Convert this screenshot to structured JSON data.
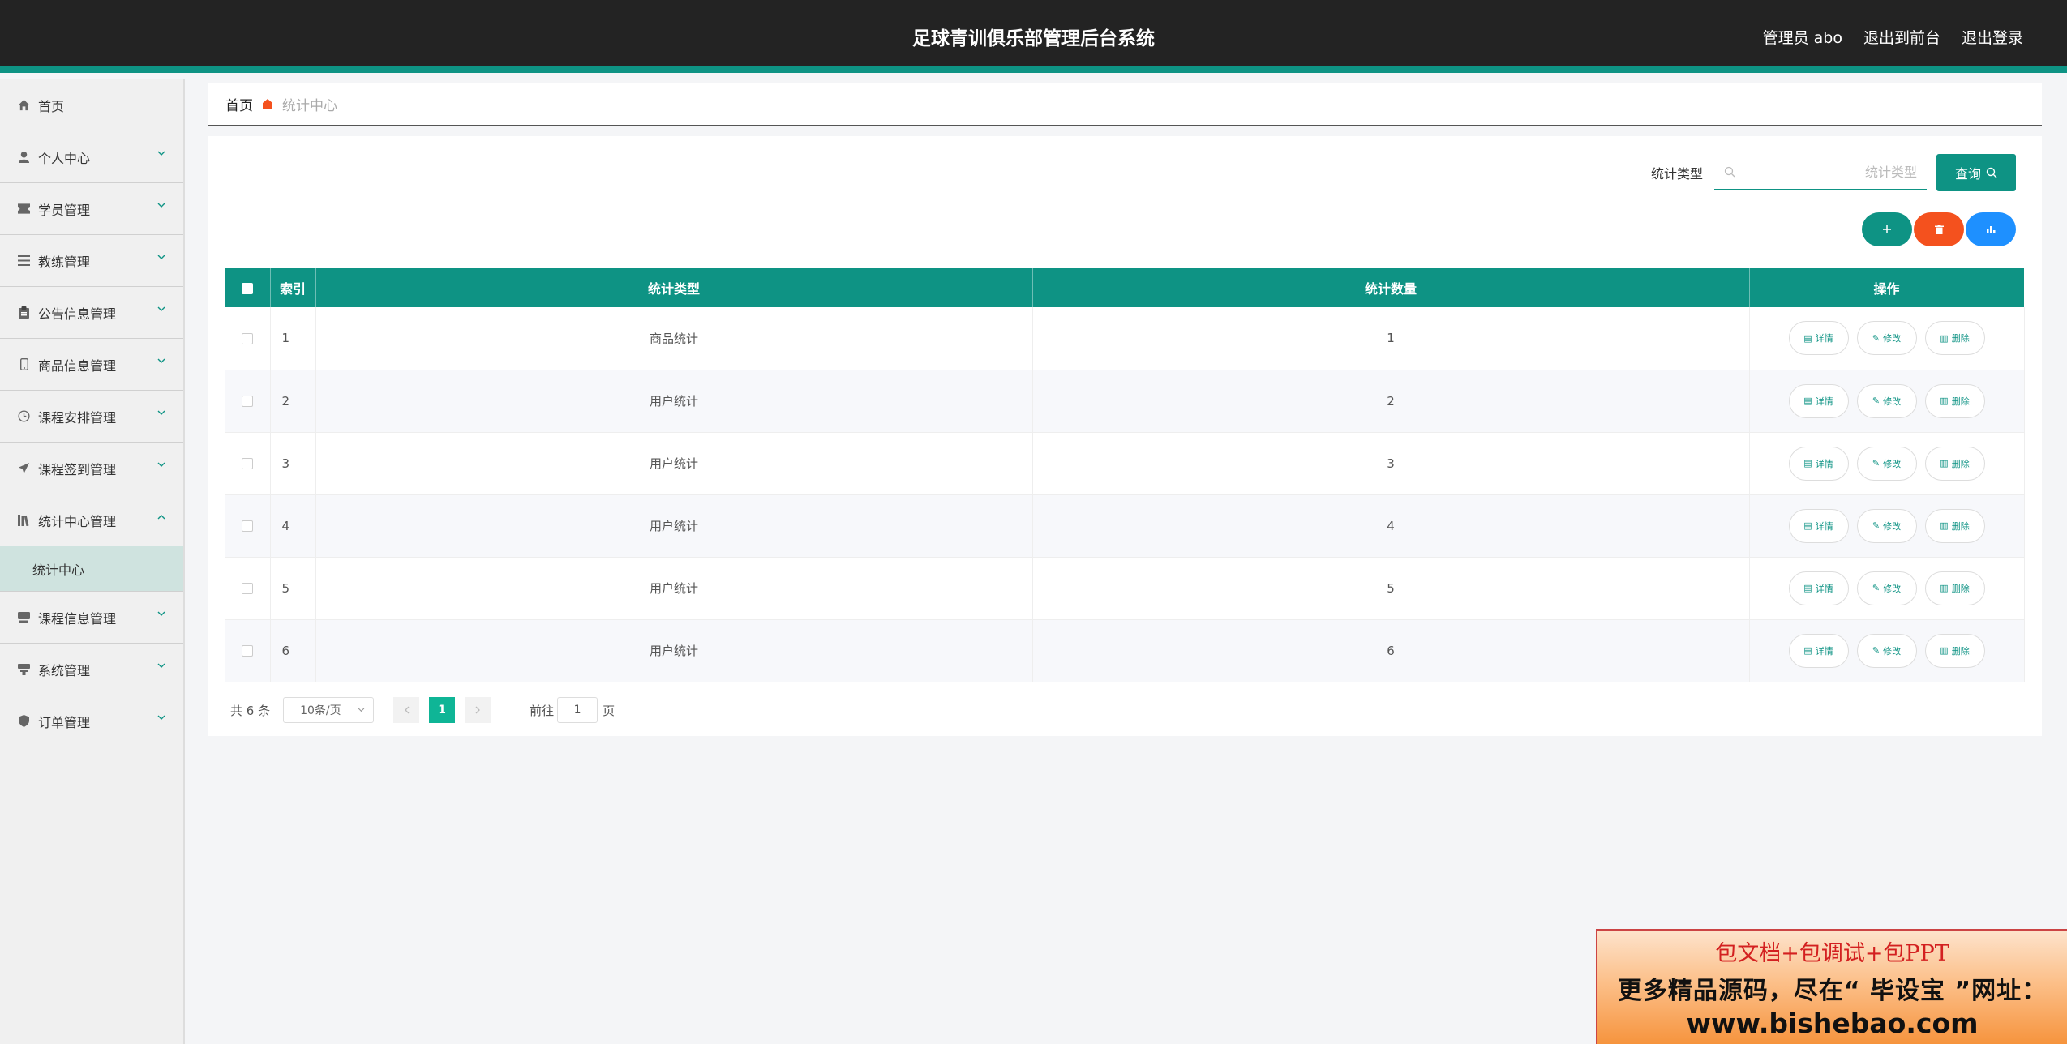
{
  "header": {
    "title": "足球青训俱乐部管理后台系统",
    "admin": "管理员 abo",
    "to_front": "退出到前台",
    "logout": "退出登录"
  },
  "sidebar": {
    "items": [
      {
        "label": "首页",
        "icon": "home-icon"
      },
      {
        "label": "个人中心",
        "icon": "user-icon"
      },
      {
        "label": "学员管理",
        "icon": "ticket-icon"
      },
      {
        "label": "教练管理",
        "icon": "list-icon"
      },
      {
        "label": "公告信息管理",
        "icon": "clipboard-icon"
      },
      {
        "label": "商品信息管理",
        "icon": "phone-icon"
      },
      {
        "label": "课程安排管理",
        "icon": "clock-icon"
      },
      {
        "label": "课程签到管理",
        "icon": "send-icon"
      },
      {
        "label": "统计中心管理",
        "icon": "library-icon"
      },
      {
        "label": "课程信息管理",
        "icon": "tray-icon"
      },
      {
        "label": "系统管理",
        "icon": "stack-icon"
      },
      {
        "label": "订单管理",
        "icon": "shield-icon"
      }
    ],
    "sub_active": "统计中心"
  },
  "breadcrumb": {
    "home": "首页",
    "current": "统计中心"
  },
  "search": {
    "label": "统计类型",
    "placeholder": "统计类型",
    "button": "查询"
  },
  "table": {
    "headers": [
      "索引",
      "统计类型",
      "统计数量",
      "操作"
    ],
    "rows": [
      {
        "index": "1",
        "type": "商品统计",
        "count": "1"
      },
      {
        "index": "2",
        "type": "用户统计",
        "count": "2"
      },
      {
        "index": "3",
        "type": "用户统计",
        "count": "3"
      },
      {
        "index": "4",
        "type": "用户统计",
        "count": "4"
      },
      {
        "index": "5",
        "type": "用户统计",
        "count": "5"
      },
      {
        "index": "6",
        "type": "用户统计",
        "count": "6"
      }
    ],
    "ops": {
      "detail": "详情",
      "edit": "修改",
      "delete": "删除"
    }
  },
  "pager": {
    "total": "共 6 条",
    "page_size": "10条/页",
    "current_page": "1",
    "goto_label": "前往",
    "goto_value": "1",
    "page_unit": "页"
  },
  "promo": {
    "line1": "包文档+包调试+包PPT",
    "line2": "更多精品源码，尽在“ 毕设宝 ”网址：",
    "line3": "www.bishebao.com"
  },
  "colors": {
    "primary": "#0e9384",
    "danger": "#f4511e",
    "info": "#1e90ff",
    "header_bg": "#232323"
  }
}
